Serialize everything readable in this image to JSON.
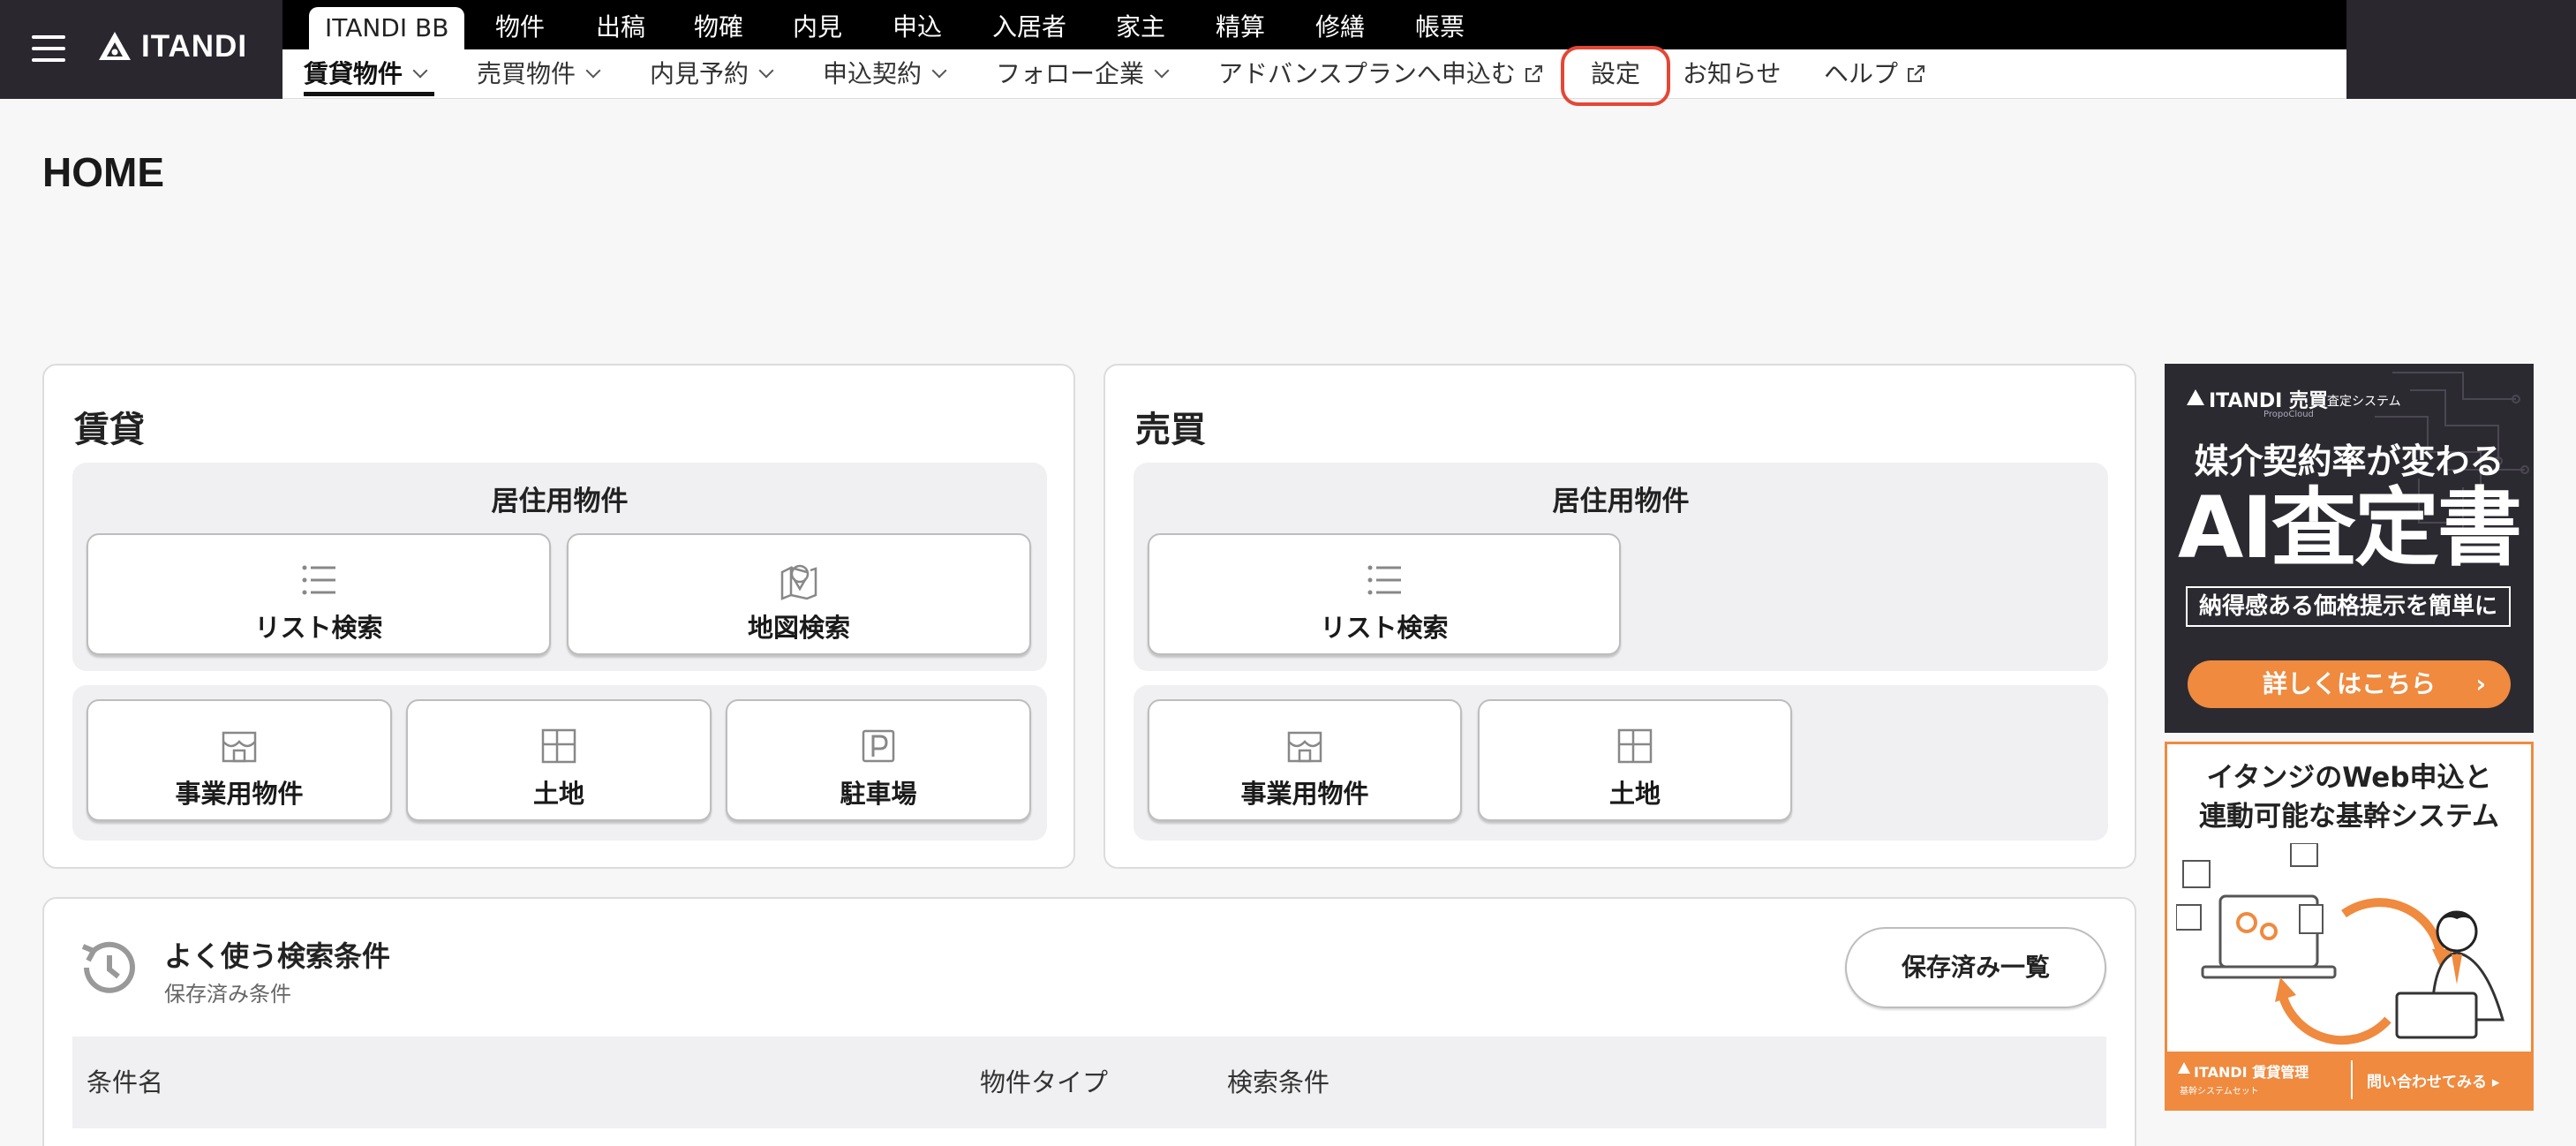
{
  "header": {
    "brand": "ITANDI",
    "top_tabs": [
      {
        "label": "ITANDI BB",
        "active": true
      },
      {
        "label": "物件"
      },
      {
        "label": "出稿"
      },
      {
        "label": "物確"
      },
      {
        "label": "内見"
      },
      {
        "label": "申込"
      },
      {
        "label": "入居者"
      },
      {
        "label": "家主"
      },
      {
        "label": "精算"
      },
      {
        "label": "修繕"
      },
      {
        "label": "帳票"
      }
    ],
    "sub_nav": [
      {
        "label": "賃貸物件",
        "active": true,
        "dropdown": true
      },
      {
        "label": "売買物件",
        "dropdown": true
      },
      {
        "label": "内見予約",
        "dropdown": true
      },
      {
        "label": "申込契約",
        "dropdown": true
      },
      {
        "label": "フォロー企業",
        "dropdown": true
      },
      {
        "label": "アドバンスプランへ申込む",
        "external": true
      },
      {
        "label": "設定",
        "highlighted": true
      },
      {
        "label": "お知らせ"
      },
      {
        "label": "ヘルプ",
        "external": true
      }
    ],
    "highlight_color": "#e44735"
  },
  "page": {
    "title": "HOME"
  },
  "rental": {
    "title": "賃貸",
    "residential_title": "居住用物件",
    "list_search": "リスト検索",
    "map_search": "地図検索",
    "business": "事業用物件",
    "land": "土地",
    "parking": "駐車場"
  },
  "sale": {
    "title": "売買",
    "residential_title": "居住用物件",
    "list_search": "リスト検索",
    "business": "事業用物件",
    "land": "土地"
  },
  "favorites": {
    "title": "よく使う検索条件",
    "subtitle": "保存済み条件",
    "saved_list_button": "保存済み一覧",
    "columns": [
      "条件名",
      "物件タイプ",
      "検索条件"
    ]
  },
  "ads": {
    "ad1": {
      "brand": "ITANDI 売買",
      "brand_sub": "PropoCloud",
      "system": "査定システム",
      "headline": "媒介契約率が変わる",
      "big": "AI査定書",
      "tagline": "納得感ある価格提示を簡単に",
      "cta": "詳しくはこちら",
      "accent": "#ef8a3f"
    },
    "ad2": {
      "headline_line1": "イタンジのWeb申込と",
      "headline_line2": "連動可能な基幹システム",
      "footer_brand": "ITANDI 賃貸管理",
      "footer_sub": "基幹システムセット",
      "footer_cta": "問い合わせてみる",
      "accent": "#ef8a3f"
    }
  }
}
